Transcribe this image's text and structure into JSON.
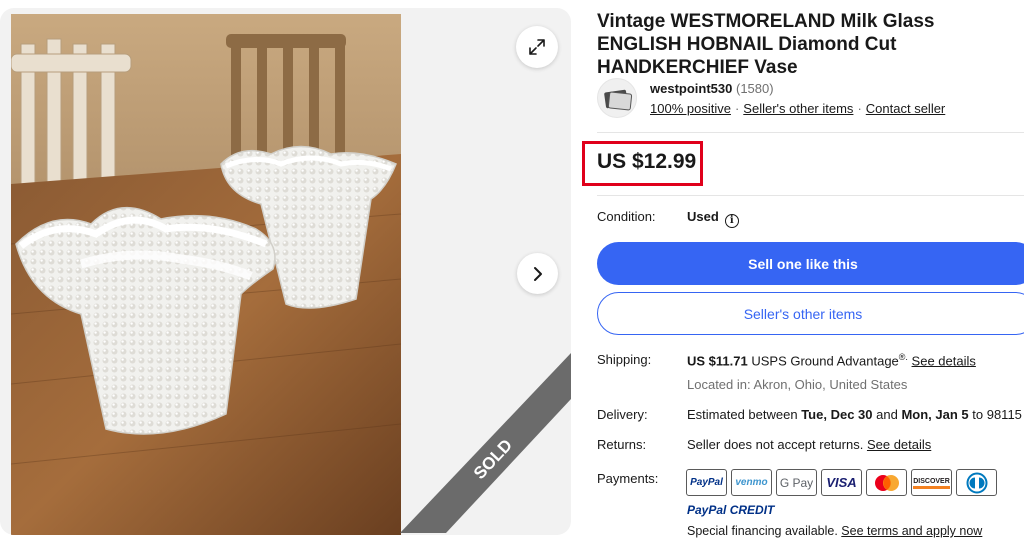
{
  "listing": {
    "title": "Vintage WESTMORELAND Milk Glass ENGLISH HOBNAIL Diamond Cut HANDKERCHIEF Vase",
    "price": "US $12.99",
    "sold_ribbon": "SOLD"
  },
  "gallery": {
    "expand_icon": "expand-icon",
    "next_icon": "chevron-right-icon"
  },
  "seller": {
    "name": "westpoint530",
    "feedback_count": "(1580)",
    "positive": "100% positive",
    "other_items": "Seller's other items",
    "contact": "Contact seller"
  },
  "condition": {
    "label": "Condition:",
    "value": "Used"
  },
  "buttons": {
    "sell_one": "Sell one like this",
    "other_items": "Seller's other items"
  },
  "shipping": {
    "label": "Shipping:",
    "cost": "US $11.71",
    "service": "USPS Ground Advantage",
    "reg": "®.",
    "see_details": "See details",
    "location": "Located in: Akron, Ohio, United States"
  },
  "delivery": {
    "label": "Delivery:",
    "prefix": "Estimated between",
    "date1": "Tue, Dec 30",
    "and": "and",
    "date2": "Mon, Jan 5",
    "suffix": "to 98115"
  },
  "returns": {
    "label": "Returns:",
    "text": "Seller does not accept returns.",
    "see_details": "See details"
  },
  "payments": {
    "label": "Payments:",
    "methods": [
      "PayPal",
      "venmo",
      "G Pay",
      "VISA",
      "Mastercard",
      "DISCOVER",
      "Diners Club"
    ],
    "paypal_credit_a": "PayPal",
    "paypal_credit_b": "CREDIT",
    "financing_text": "Special financing available.",
    "financing_link": "See terms and apply now"
  },
  "colors": {
    "primary_blue": "#3665f3",
    "highlight_red": "#e0001b",
    "sold_ribbon": "#6b6b6b"
  }
}
